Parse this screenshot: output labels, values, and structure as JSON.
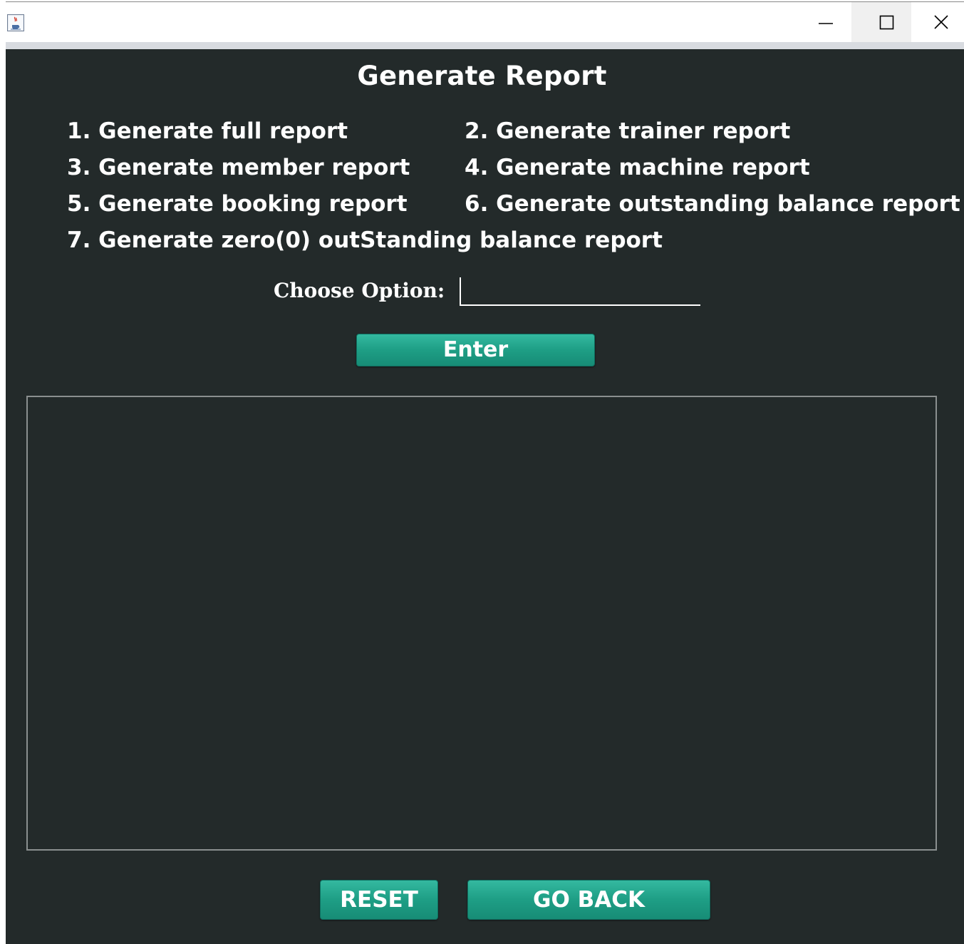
{
  "window": {
    "title": "",
    "icon": "java-cup-icon",
    "controls": {
      "minimize": "minimize-icon",
      "maximize": "maximize-icon",
      "close": "close-icon"
    }
  },
  "colors": {
    "background": "#232a2a",
    "accent": "#1e9e85",
    "text": "#ffffff"
  },
  "heading": "Generate Report",
  "options": [
    "1. Generate full report",
    "2. Generate trainer report",
    "3. Generate member report",
    "4. Generate machine report",
    "5. Generate booking report",
    "6. Generate outstanding balance report",
    "7. Generate zero(0) outStanding balance report"
  ],
  "choose": {
    "label": "Choose Option:",
    "value": ""
  },
  "buttons": {
    "enter": "Enter",
    "reset": "RESET",
    "go_back": "GO BACK"
  },
  "output": {
    "value": ""
  }
}
